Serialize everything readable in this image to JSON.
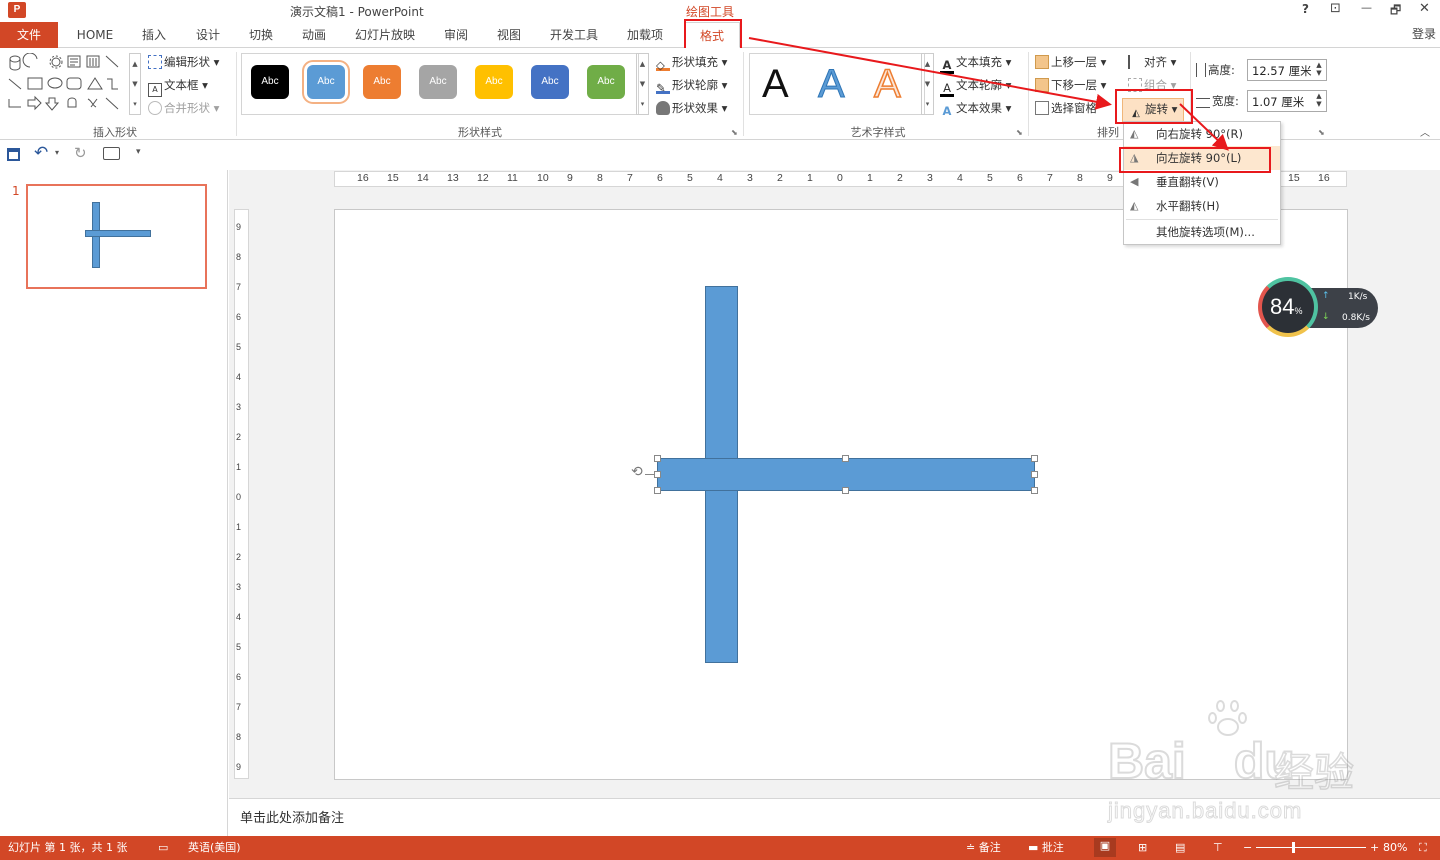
{
  "titlebar": {
    "title": "演示文稿1 - PowerPoint",
    "context_group": "绘图工具",
    "help": "?",
    "ribbon_display": "⊡",
    "minimize": "—",
    "restore": "🗗",
    "close": "✕"
  },
  "tabs": {
    "file": "文件",
    "items": [
      "HOME",
      "插入",
      "设计",
      "切换",
      "动画",
      "幻灯片放映",
      "审阅",
      "视图",
      "开发工具",
      "加载项"
    ],
    "format": "格式",
    "login": "登录"
  },
  "ribbon": {
    "insert_shapes": {
      "edit_shape": "编辑形状",
      "text_box": "文本框",
      "merge_shapes": "合并形状",
      "label": "插入形状"
    },
    "shape_styles": {
      "swatch_label": "Abc",
      "swatches": [
        "#000000",
        "#5b9bd5",
        "#ed7d31",
        "#a5a5a5",
        "#ffc000",
        "#4472c4",
        "#70ad47"
      ],
      "shape_fill": "形状填充",
      "shape_outline": "形状轮廓",
      "shape_effects": "形状效果",
      "label": "形状样式"
    },
    "wordart": {
      "glyph": "A",
      "text_fill": "文本填充",
      "text_outline": "文本轮廓",
      "text_effects": "文本效果",
      "label": "艺术字样式"
    },
    "arrange": {
      "bring_forward": "上移一层",
      "send_backward": "下移一层",
      "selection_pane": "选择窗格",
      "align": "对齐",
      "group": "组合",
      "rotate": "旋转",
      "label": "排列"
    },
    "size": {
      "height_label": "高度:",
      "height_value": "12.57 厘米",
      "width_label": "宽度:",
      "width_value": "1.07 厘米"
    }
  },
  "rotate_menu": {
    "items": [
      "向右旋转 90°(R)",
      "向左旋转 90°(L)",
      "垂直翻转(V)",
      "水平翻转(H)"
    ],
    "more": "其他旋转选项(M)..."
  },
  "slides_panel": {
    "slide_number": "1"
  },
  "ruler": {
    "h_ticks": [
      "16",
      "15",
      "14",
      "13",
      "12",
      "11",
      "10",
      "9",
      "8",
      "7",
      "6",
      "5",
      "4",
      "3",
      "2",
      "1",
      "0",
      "1",
      "2",
      "3",
      "4",
      "5",
      "6",
      "7",
      "8",
      "9",
      "15",
      "16"
    ],
    "v_ticks": [
      "9",
      "8",
      "7",
      "6",
      "5",
      "4",
      "3",
      "2",
      "1",
      "0",
      "1",
      "2",
      "3",
      "4",
      "5",
      "6",
      "7",
      "8",
      "9"
    ]
  },
  "notes": {
    "placeholder": "单击此处添加备注"
  },
  "net_widget": {
    "percent": "84",
    "percent_sign": "%",
    "up": "1K/s",
    "down": "0.8K/s"
  },
  "watermark": {
    "brand": "Bai",
    "brand2": "du",
    "cn": "经验",
    "url": "jingyan.baidu.com"
  },
  "status": {
    "slide_info": "幻灯片 第 1 张，共 1 张",
    "language": "英语(美国)",
    "notes": "备注",
    "comments": "批注",
    "zoom": "80%"
  },
  "colors": {
    "accent": "#d24726",
    "shape_fill": "#5b9bd5",
    "annotation_red": "#e8191c"
  }
}
